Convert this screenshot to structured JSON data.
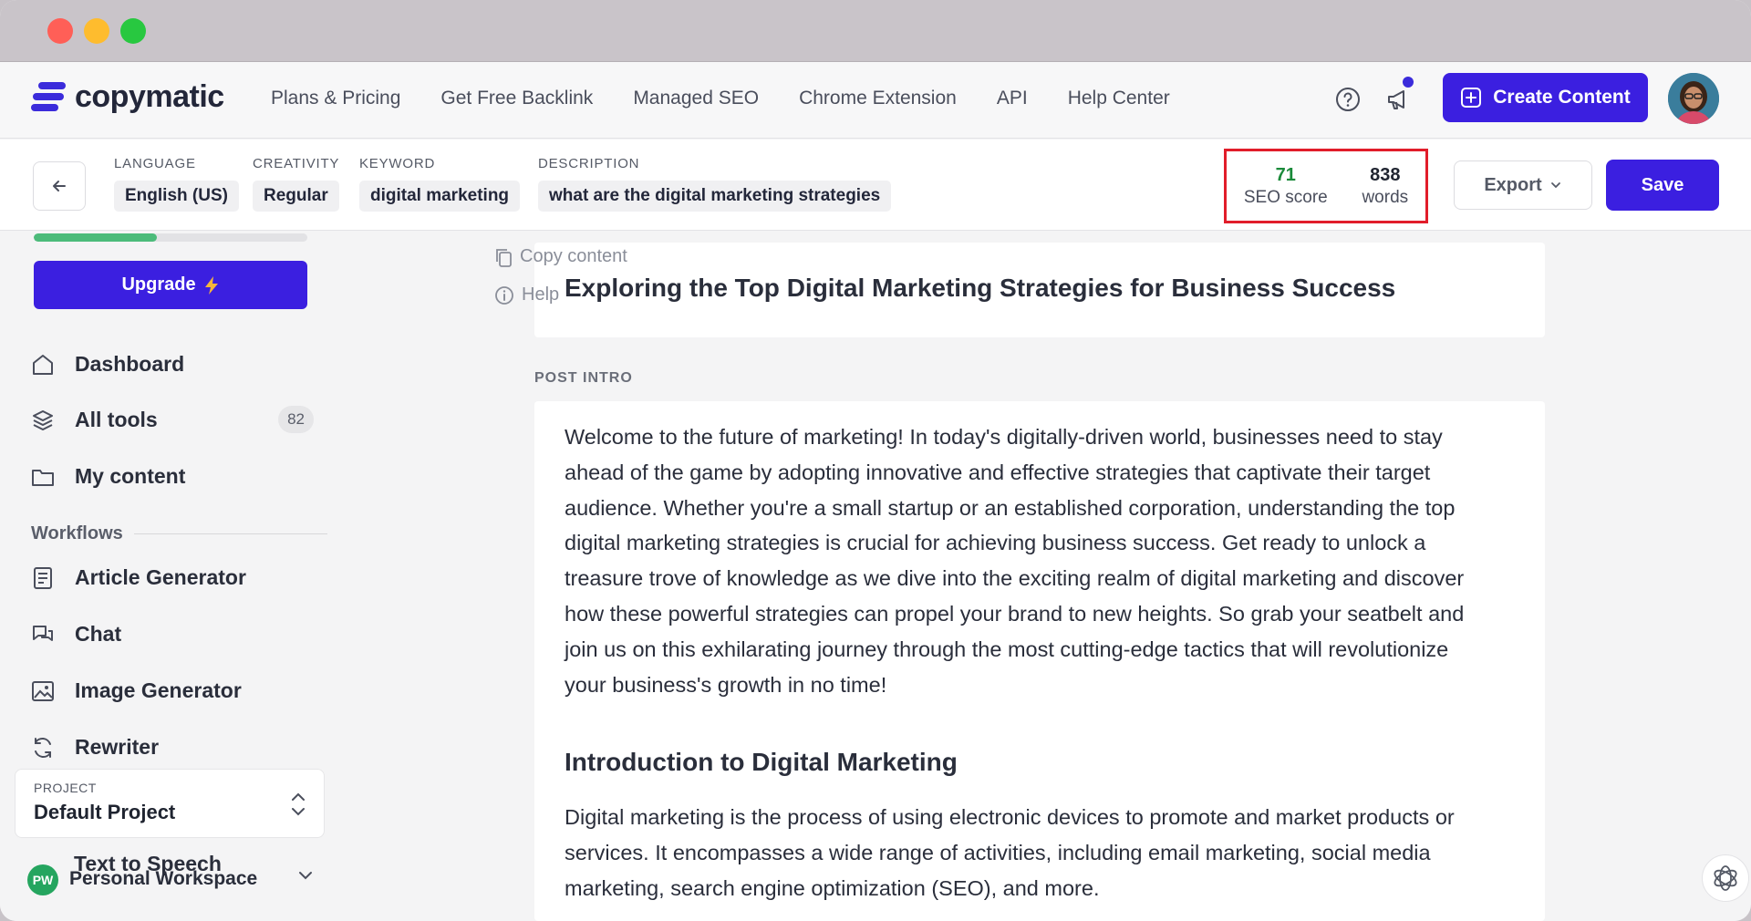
{
  "nav": {
    "brand": "copymatic",
    "links": [
      "Plans & Pricing",
      "Get Free Backlink",
      "Managed SEO",
      "Chrome Extension",
      "API",
      "Help Center"
    ],
    "create_label": "Create Content"
  },
  "settings": {
    "language_label": "LANGUAGE",
    "language_value": "English (US)",
    "creativity_label": "CREATIVITY",
    "creativity_value": "Regular",
    "keyword_label": "KEYWORD",
    "keyword_value": "digital marketing",
    "description_label": "DESCRIPTION",
    "description_value": "what are the digital marketing strategies",
    "seo_score": "71",
    "seo_score_label": "SEO score",
    "word_count": "838",
    "word_count_label": "words",
    "export_label": "Export",
    "save_label": "Save",
    "seo_score_color": "#1a8a3a"
  },
  "sidebar": {
    "usage_progress": 0.45,
    "upgrade_label": "Upgrade",
    "items": [
      {
        "label": "Dashboard",
        "icon": "home-icon"
      },
      {
        "label": "All tools",
        "icon": "layers-icon",
        "badge": "82"
      },
      {
        "label": "My content",
        "icon": "folder-icon"
      }
    ],
    "workflows_label": "Workflows",
    "workflows": [
      {
        "label": "Article Generator",
        "icon": "article-icon"
      },
      {
        "label": "Chat",
        "icon": "chat-icon"
      },
      {
        "label": "Image Generator",
        "icon": "image-icon"
      },
      {
        "label": "Rewriter",
        "icon": "refresh-icon"
      }
    ],
    "project_label": "PROJECT",
    "project_value": "Default Project",
    "behind_item": "Text to Speech",
    "workspace_initials": "PW",
    "workspace_name": "Personal Workspace"
  },
  "editor": {
    "copy_label": "Copy content",
    "help_label": "Help",
    "title": "Exploring the Top Digital Marketing Strategies for Business Success",
    "section_label": "POST INTRO",
    "intro_lines": [
      "Welcome to the future of marketing! In today's digitally-driven world, businesses need to stay",
      "ahead of the game by adopting innovative and effective strategies that captivate their target",
      "audience. Whether you're a small startup or an established corporation, understanding the top",
      "digital marketing strategies is crucial for achieving business success. Get ready to unlock a",
      "treasure trove of knowledge as we dive into the exciting realm of digital marketing and discover",
      "how these powerful strategies can propel your brand to new heights. So grab your seatbelt and",
      "join us on this exhilarating journey through the most cutting-edge tactics that will revolutionize",
      "your business's growth in no time!"
    ],
    "heading": "Introduction to Digital Marketing",
    "body_lines": [
      "Digital marketing is the process of using electronic devices to promote and market products or",
      "services. It encompasses a wide range of activities, including email marketing, social media",
      "marketing, search engine optimization (SEO), and more."
    ]
  }
}
